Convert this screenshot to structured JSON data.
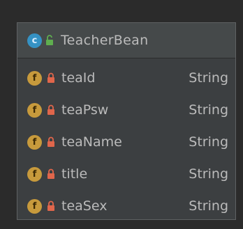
{
  "diagram": {
    "class": {
      "badge": "c",
      "icon": "class-icon",
      "visibility_icon": "public-unlocked-icon",
      "name": "TeacherBean"
    },
    "fields": [
      {
        "badge": "f",
        "icon": "field-icon",
        "visibility_icon": "private-lock-icon",
        "name": "teaId",
        "type": "String"
      },
      {
        "badge": "f",
        "icon": "field-icon",
        "visibility_icon": "private-lock-icon",
        "name": "teaPsw",
        "type": "String"
      },
      {
        "badge": "f",
        "icon": "field-icon",
        "visibility_icon": "private-lock-icon",
        "name": "teaName",
        "type": "String"
      },
      {
        "badge": "f",
        "icon": "field-icon",
        "visibility_icon": "private-lock-icon",
        "name": "title",
        "type": "String"
      },
      {
        "badge": "f",
        "icon": "field-icon",
        "visibility_icon": "private-lock-icon",
        "name": "teaSex",
        "type": "String"
      }
    ],
    "colors": {
      "background": "#2b2b2b",
      "card": "#3c3f41",
      "header": "#45494a",
      "class_icon": "#3592c4",
      "field_icon": "#c79a3c",
      "lock": "#e0664b",
      "unlock": "#5fae4f",
      "text": "#bbbbbb"
    }
  }
}
